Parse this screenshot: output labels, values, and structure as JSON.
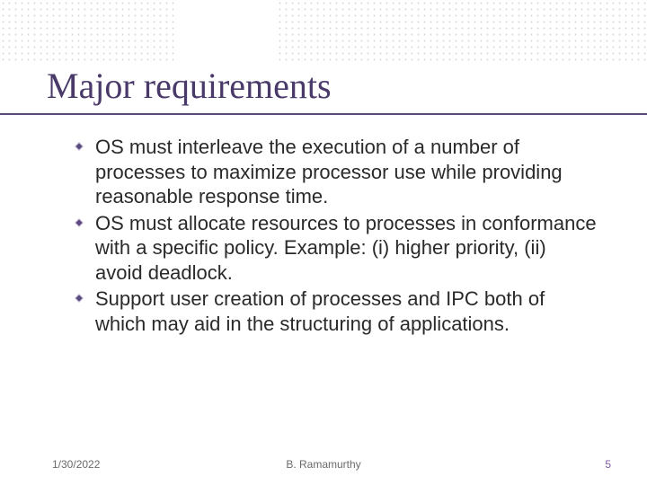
{
  "title": "Major requirements",
  "bullets": [
    "OS must interleave the execution of a number of processes to maximize processor use while providing reasonable response time.",
    "OS must allocate resources to processes in conformance with a specific policy. Example: (i) higher priority, (ii) avoid deadlock.",
    "Support user creation of processes and IPC both of which may aid in the structuring of applications."
  ],
  "footer": {
    "date": "1/30/2022",
    "author": "B. Ramamurthy",
    "page": "5"
  },
  "colors": {
    "title": "#4a3a6a",
    "accent": "#7a5aa0"
  }
}
